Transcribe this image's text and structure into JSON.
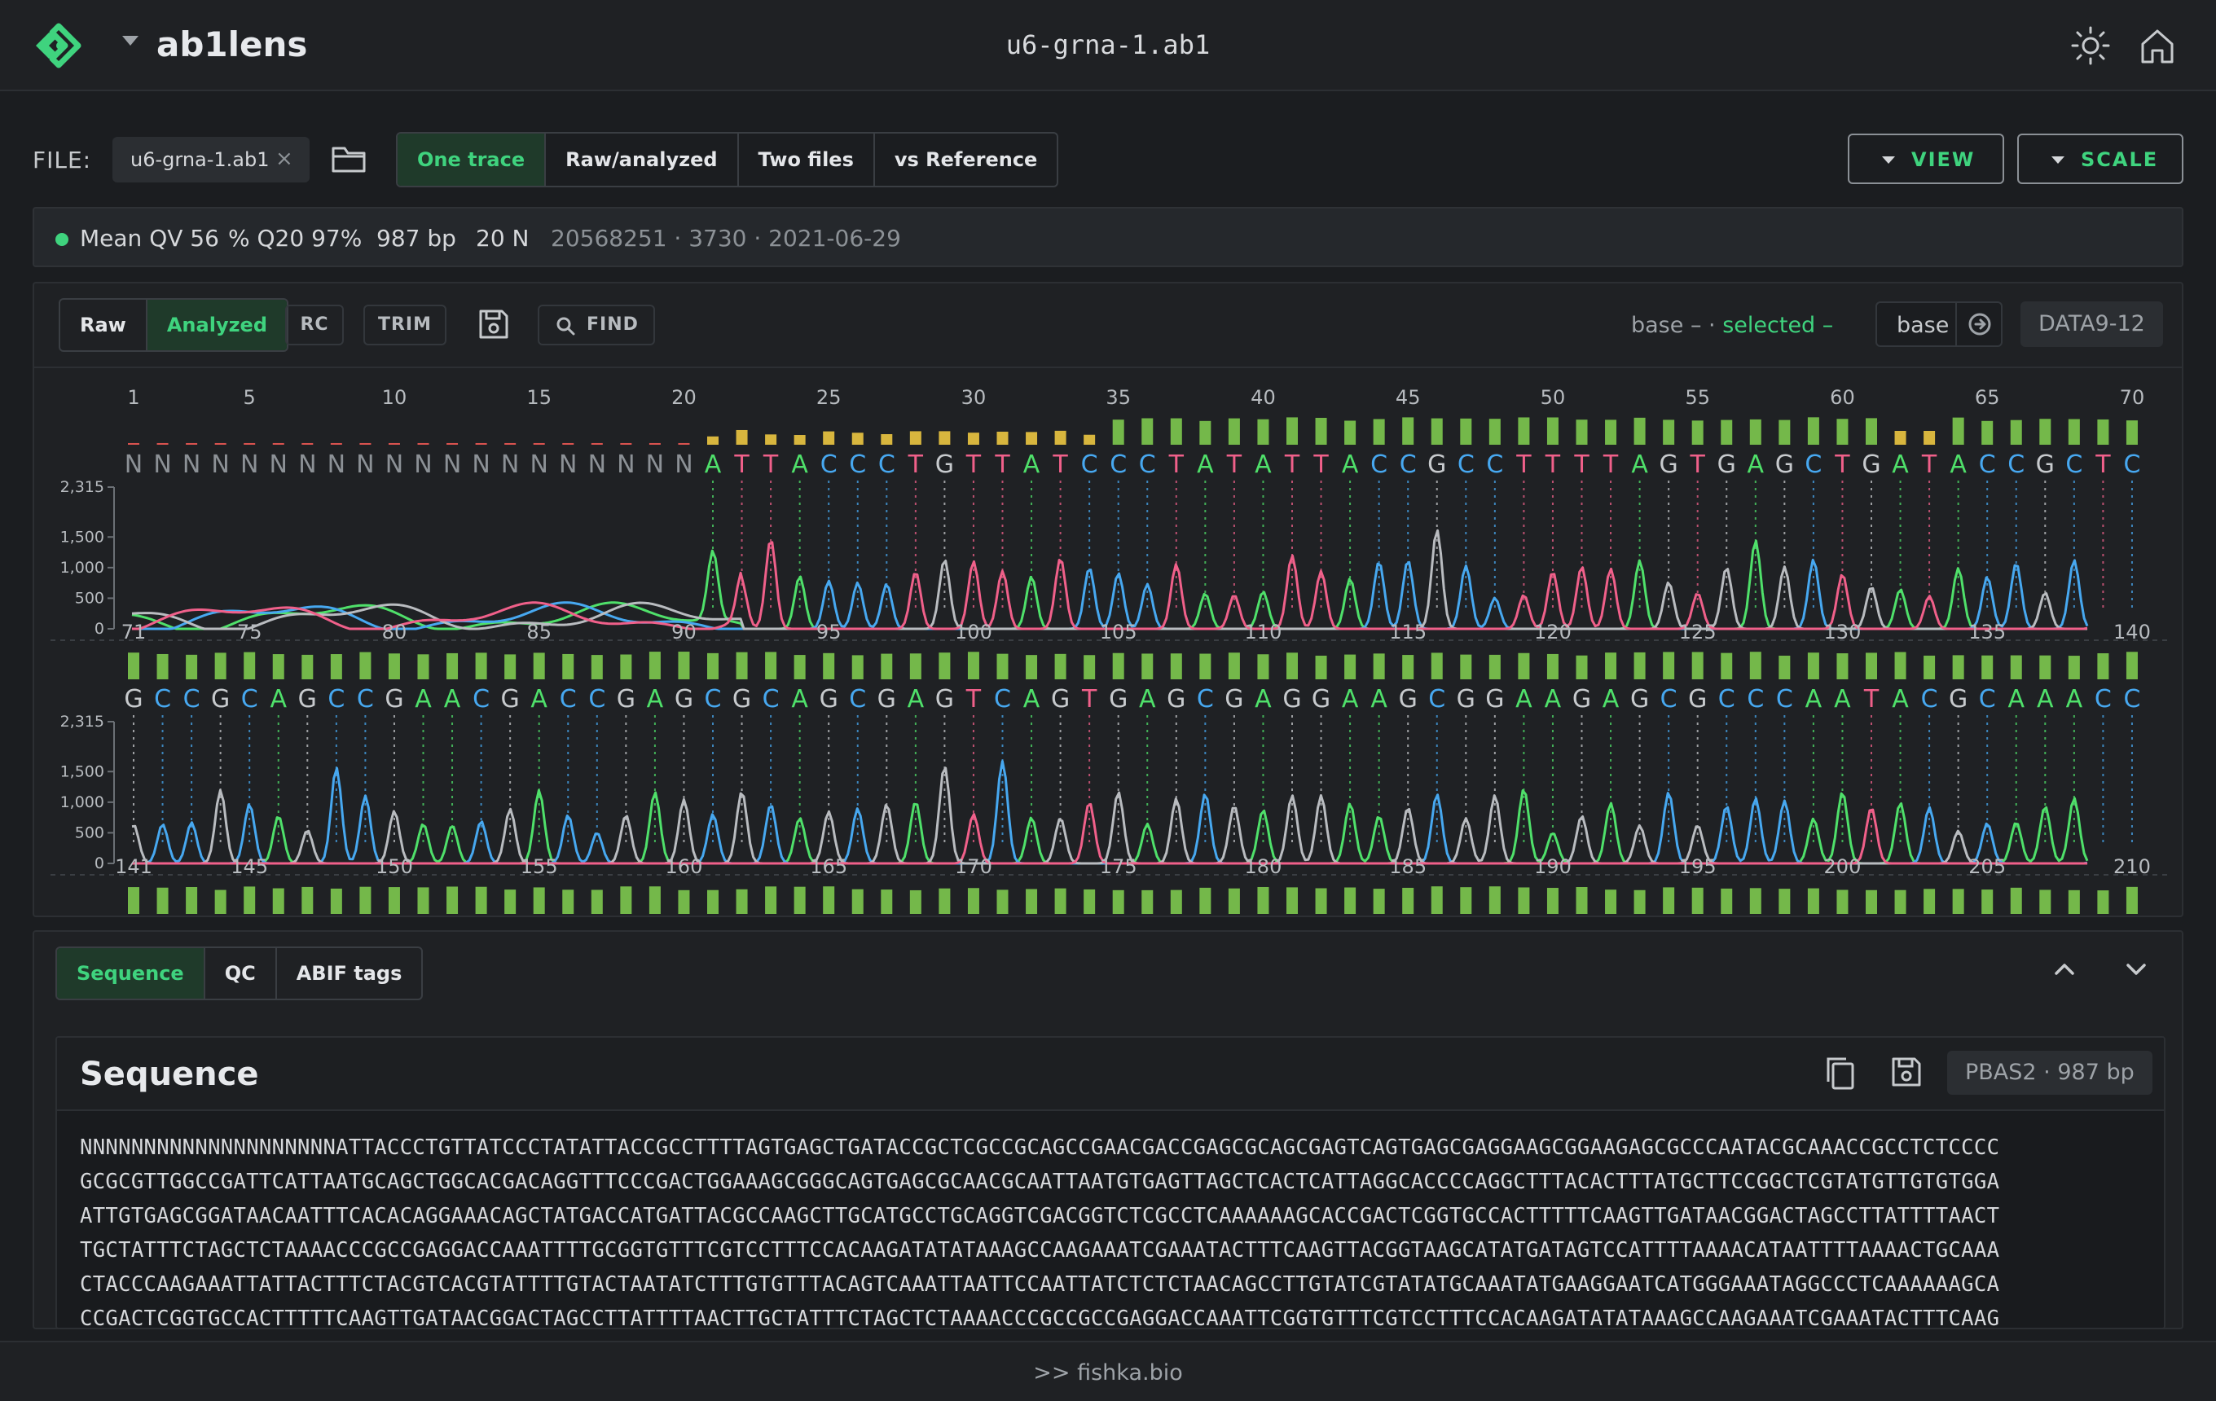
{
  "header": {
    "app_name": "ab1lens",
    "file_title": "u6-grna-1.ab1"
  },
  "file_bar": {
    "label": "FILE:",
    "file_name": "u6-grna-1.ab1",
    "close_glyph": "×",
    "modes": [
      "One trace",
      "Raw/analyzed",
      "Two files",
      "vs Reference"
    ],
    "active_mode": "One trace",
    "view_label": "VIEW",
    "scale_label": "SCALE"
  },
  "stats": {
    "mean_qv": "Mean QV 56",
    "q20": "% Q20 97%",
    "length": "987 bp",
    "n_count": "20 N",
    "meta": "20568251 · 3730 · 2021-06-29"
  },
  "trace_toolbar": {
    "raw_label": "Raw",
    "analyzed_label": "Analyzed",
    "rc_label": "RC",
    "trim_label": "TRIM",
    "find_label": "FIND",
    "legend_prefix": "base – ·",
    "legend_selected": "selected –",
    "base_input": "base",
    "data_channels": "DATA9-12"
  },
  "chart_data": {
    "type": "line",
    "title": "",
    "rows": [
      {
        "start": 1,
        "ticks": [
          1,
          5,
          10,
          15,
          20,
          25,
          30,
          35,
          40,
          45,
          50,
          55,
          60,
          65,
          70
        ],
        "bases": "NNNNNNNNNNNNNNNNNNNNATTACCCTGTTATCCCTATATTACCGCCTTTTAGTGAGCTGATACCGCTC",
        "y_ticks": [
          "2,315",
          "1,500",
          "1,000",
          "500",
          "0"
        ],
        "ylim": [
          0,
          2315
        ]
      },
      {
        "start": 71,
        "ticks": [
          71,
          75,
          80,
          85,
          90,
          95,
          100,
          105,
          110,
          115,
          120,
          125,
          130,
          135,
          140
        ],
        "bases": "GCCGCAGCCGAACGACCGAGCGCAGCGAGTCAGTGAGCGAGGAAGCGGAAGAGCGCCCAATACGCAAACC",
        "y_ticks": [
          "2,315",
          "1,500",
          "1,000",
          "500",
          "0"
        ],
        "ylim": [
          0,
          2315
        ]
      },
      {
        "start": 141,
        "ticks": [
          141,
          145,
          150,
          155,
          160,
          165,
          170,
          175,
          180,
          185,
          190,
          195,
          200,
          205,
          210
        ],
        "bases": "",
        "y_ticks": [],
        "ylim": [
          0,
          2315
        ]
      }
    ],
    "series": [
      {
        "name": "A",
        "color": "#4fe06a"
      },
      {
        "name": "C",
        "color": "#47a8f0"
      },
      {
        "name": "G",
        "color": "#b9bcc0"
      },
      {
        "name": "T",
        "color": "#f0608a"
      }
    ],
    "base_colors": {
      "A": "#4fe06a",
      "C": "#47a8f0",
      "G": "#c7cacd",
      "T": "#f0608a",
      "N": "#8c9196"
    }
  },
  "seq_panel": {
    "tabs": [
      "Sequence",
      "QC",
      "ABIF tags"
    ],
    "active_tab": "Sequence",
    "title": "Sequence",
    "chip": "PBAS2 · 987 bp",
    "lines": [
      "NNNNNNNNNNNNNNNNNNNNATTACCCTGTTATCCCTATATTACCGCCTTTTAGTGAGCTGATACCGCTCGCCGCAGCCGAACGACCGAGCGCAGCGAGTCAGTGAGCGAGGAAGCGGAAGAGCGCCCAATACGCAAACCGCCTCTCCCC",
      "GCGCGTTGGCCGATTCATTAATGCAGCTGGCACGACAGGTTTCCCGACTGGAAAGCGGGCAGTGAGCGCAACGCAATTAATGTGAGTTAGCTCACTCATTAGGCACCCCAGGCTTTACACTTTATGCTTCCGGCTCGTATGTTGTGTGGA",
      "ATTGTGAGCGGATAACAATTTCACACAGGAAACAGCTATGACCATGATTACGCCAAGCTTGCATGCCTGCAGGTCGACGGTCTCGCCTCAAAAAAGCACCGACTCGGTGCCACTTTTTCAAGTTGATAACGGACTAGCCTTATTTTAACT",
      "TGCTATTTCTAGCTCTAAAACCCGCCGAGGACCAAATTTTGCGGTGTTTCGTCCTTTCCACAAGATATATAAAGCCAAGAAATCGAAATACTTTCAAGTTACGGTAAGCATATGATAGTCCATTTTAAAACATAATTTTAAAACTGCAAA",
      "CTACCCAAGAAATTATTACTTTCTACGTCACGTATTTTGTACTAATATCTTTGTGTTTACAGTCAAATTAATTCCAATTATCTCTCTAACAGCCTTGTATCGTATATGCAAATATGAAGGAATCATGGGAAATAGGCCCTCAAAAAAGCA",
      "CCGACTCGGTGCCACTTTTTCAAGTTGATAACGGACTAGCCTTATTTTAACTTGCTATTTCTAGCTCTAAAACCCGCCGCCGAGGACCAAATTCGGTGTTTCGTCCTTTCCACAAGATATATAAAGCCAAGAAATCGAAATACTTTCAAG"
    ]
  },
  "footer": {
    "text": ">> fishka.bio"
  }
}
